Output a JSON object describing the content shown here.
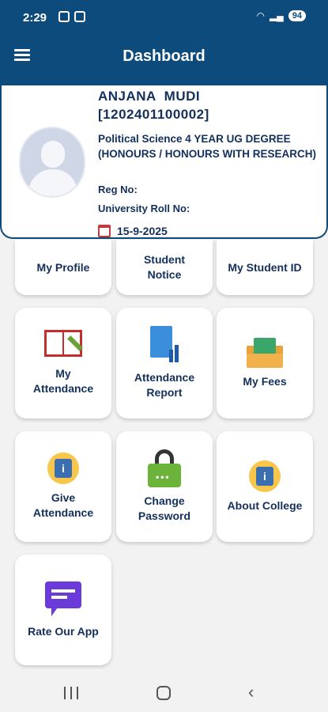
{
  "status": {
    "time": "2:29",
    "battery": "94"
  },
  "header": {
    "title": "Dashboard"
  },
  "profile": {
    "name": "ANJANA  MUDI",
    "roll": "[1202401100002]",
    "course": "Political Science 4 YEAR UG DEGREE (HONOURS / HONOURS WITH RESEARCH)",
    "reg_label": "Reg No:",
    "univ_roll_label": "University Roll No:",
    "date": "15-9-2025"
  },
  "tiles": {
    "my_profile": "My Profile",
    "student_notice": "Student\nNotice",
    "my_student_id": "My Student ID",
    "my_attendance": "My\nAttendance",
    "attendance_report": "Attendance\nReport",
    "my_fees": "My Fees",
    "give_attendance": "Give\nAttendance",
    "change_password": "Change\nPassword",
    "about_college": "About College",
    "rate_app": "Rate Our App"
  },
  "colors": {
    "header": "#0d4b7d",
    "label": "#13305c",
    "background": "#f2f2f2"
  }
}
